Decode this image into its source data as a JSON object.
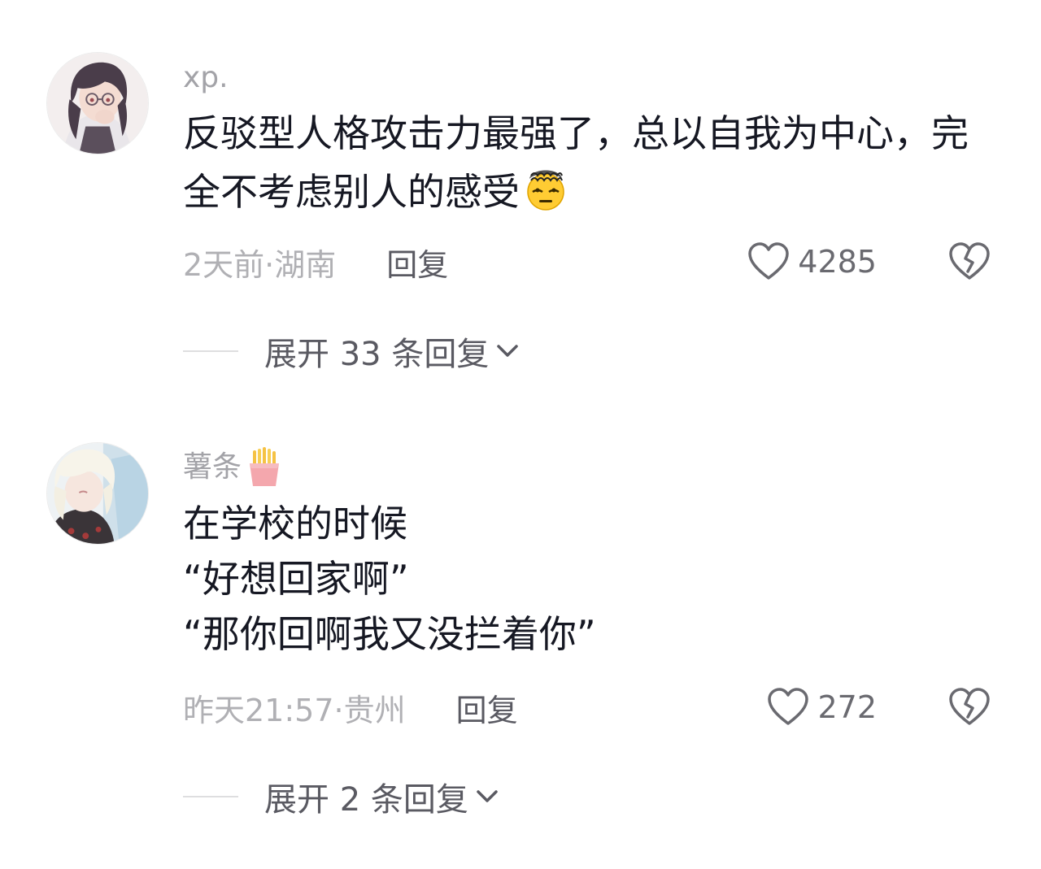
{
  "comments": [
    {
      "username": "xp.",
      "username_emoji": "",
      "avatar_icon": "anime-girl-glasses-avatar",
      "text": "反驳型人格攻击力最强了，总以自我为中心，完全不考虑别人的感受",
      "text_emoji": "exploding-head-emoji",
      "time_location": "2天前·湖南",
      "reply_label": "回复",
      "like_count": "4285",
      "expand_label": "展开 33 条回复"
    },
    {
      "username": "薯条",
      "username_emoji": "french-fries-emoji",
      "avatar_icon": "anime-boy-white-hair-avatar",
      "text": "在学校的时候\n“好想回家啊”\n“那你回啊我又没拦着你”",
      "time_location": "昨天21:57·贵州",
      "reply_label": "回复",
      "like_count": "272",
      "expand_label": "展开 2 条回复"
    }
  ],
  "colors": {
    "primary_text": "#161823",
    "secondary_text": "#a3a3a8",
    "action_text": "#5a5a62"
  }
}
